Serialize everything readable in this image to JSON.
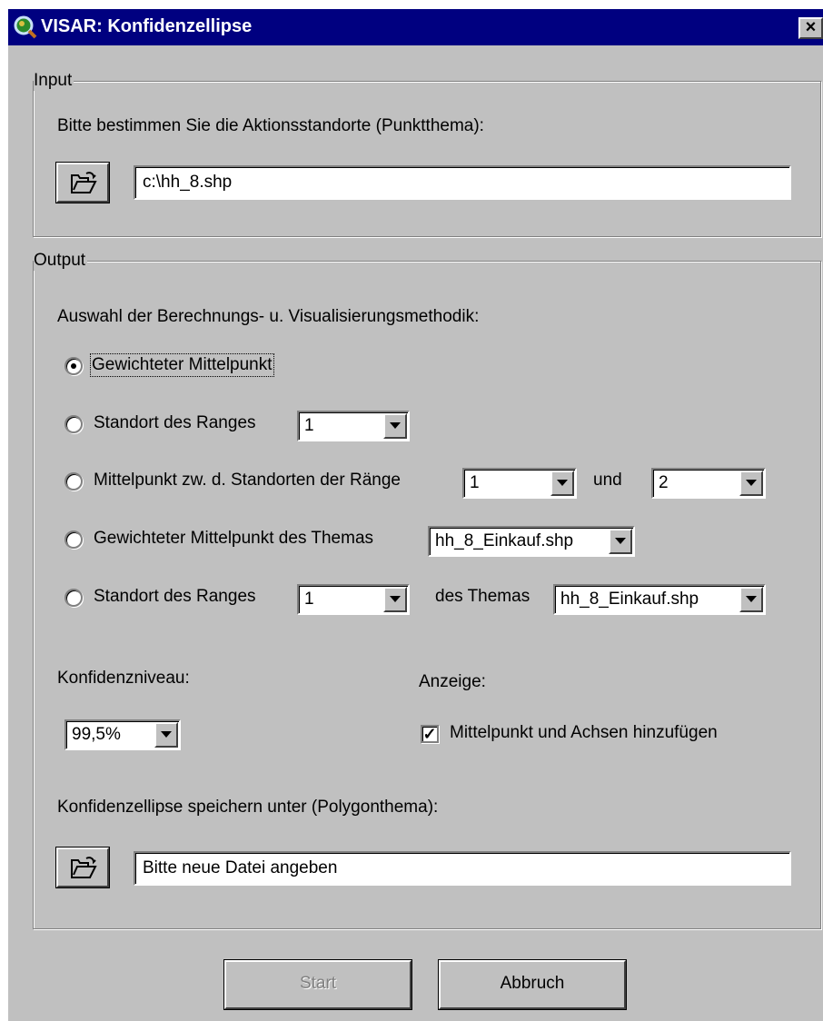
{
  "window": {
    "title": "VISAR: Konfidenzellipse",
    "icon": "globe-magnifier-icon",
    "close_label": "×"
  },
  "input": {
    "group_label": "Input",
    "prompt": "Bitte bestimmen Sie die Aktionsstandorte (Punktthema):",
    "browse_icon": "open-folder-icon",
    "file_value": "c:\\hh_8.shp"
  },
  "output": {
    "group_label": "Output",
    "method_prompt": "Auswahl der Berechnungs- u. Visualisierungsmethodik:",
    "options": [
      {
        "label": "Gewichteter Mittelpunkt",
        "checked": true
      },
      {
        "label": "Standort des Ranges",
        "checked": false,
        "combo": "1"
      },
      {
        "label": "Mittelpunkt zw. d. Standorten der Ränge",
        "checked": false,
        "combo1": "1",
        "between": "und",
        "combo2": "2"
      },
      {
        "label": "Gewichteter Mittelpunkt des Themas",
        "checked": false,
        "combo": "hh_8_Einkauf.shp"
      },
      {
        "label": "Standort des Ranges",
        "checked": false,
        "combo": "1",
        "between": "des Themas",
        "combo2": "hh_8_Einkauf.shp"
      }
    ],
    "confidence_label": "Konfidenzniveau:",
    "confidence_value": "99,5%",
    "display_label": "Anzeige:",
    "display_checkbox_label": "Mittelpunkt und Achsen hinzufügen",
    "display_checked": true,
    "save_prompt": "Konfidenzellipse speichern unter (Polygonthema):",
    "save_value": "Bitte neue Datei angeben"
  },
  "buttons": {
    "start": "Start",
    "start_enabled": false,
    "cancel": "Abbruch"
  }
}
